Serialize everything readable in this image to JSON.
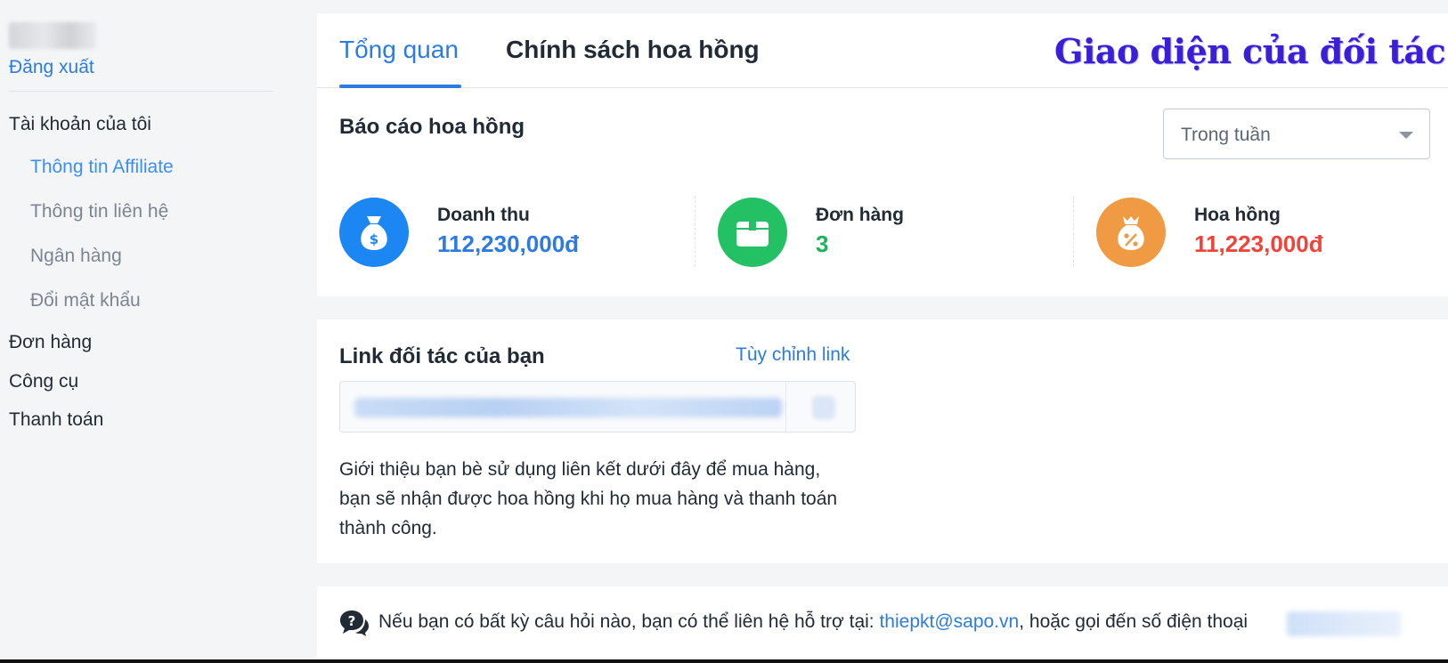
{
  "sidebar": {
    "logout": "Đăng xuất",
    "my_account": "Tài khoản của tôi",
    "sub_items": [
      {
        "label": "Thông tin Affiliate",
        "active": true
      },
      {
        "label": "Thông tin liên hệ",
        "active": false
      },
      {
        "label": "Ngân hàng",
        "active": false
      },
      {
        "label": "Đổi mật khẩu",
        "active": false
      }
    ],
    "items": [
      "Đơn hàng",
      "Công cụ",
      "Thanh toán"
    ]
  },
  "tabs": {
    "overview": "Tổng quan",
    "policy": "Chính sách hoa hồng"
  },
  "brand_title": "Giao diện của đối tác",
  "report": {
    "title": "Báo cáo hoa hồng",
    "period": "Trong tuần",
    "stats": [
      {
        "label": "Doanh thu",
        "value": "112,230,000đ",
        "color": "#2d7be0",
        "icon": "money-bag-icon",
        "icon_bg": "#1c86f2"
      },
      {
        "label": "Đơn hàng",
        "value": "3",
        "color": "#1fb45a",
        "icon": "box-icon",
        "icon_bg": "#23c064"
      },
      {
        "label": "Hoa hồng",
        "value": "11,223,000đ",
        "color": "#f0443a",
        "icon": "discount-bag-icon",
        "icon_bg": "#f09a44"
      }
    ]
  },
  "partner_link": {
    "title": "Link đối tác của bạn",
    "customize": "Tùy chỉnh link",
    "intro": "Giới thiệu bạn bè sử dụng liên kết dưới đây để mua hàng, bạn sẽ nhận được hoa hồng khi họ mua hàng và thanh toán thành công."
  },
  "help": {
    "text_before": "Nếu bạn có bất kỳ câu hỏi nào, bạn có thể liên hệ hỗ trợ tại: ",
    "email": "thiepkt@sapo.vn",
    "text_after": ", hoặc gọi đến số điện thoại"
  }
}
